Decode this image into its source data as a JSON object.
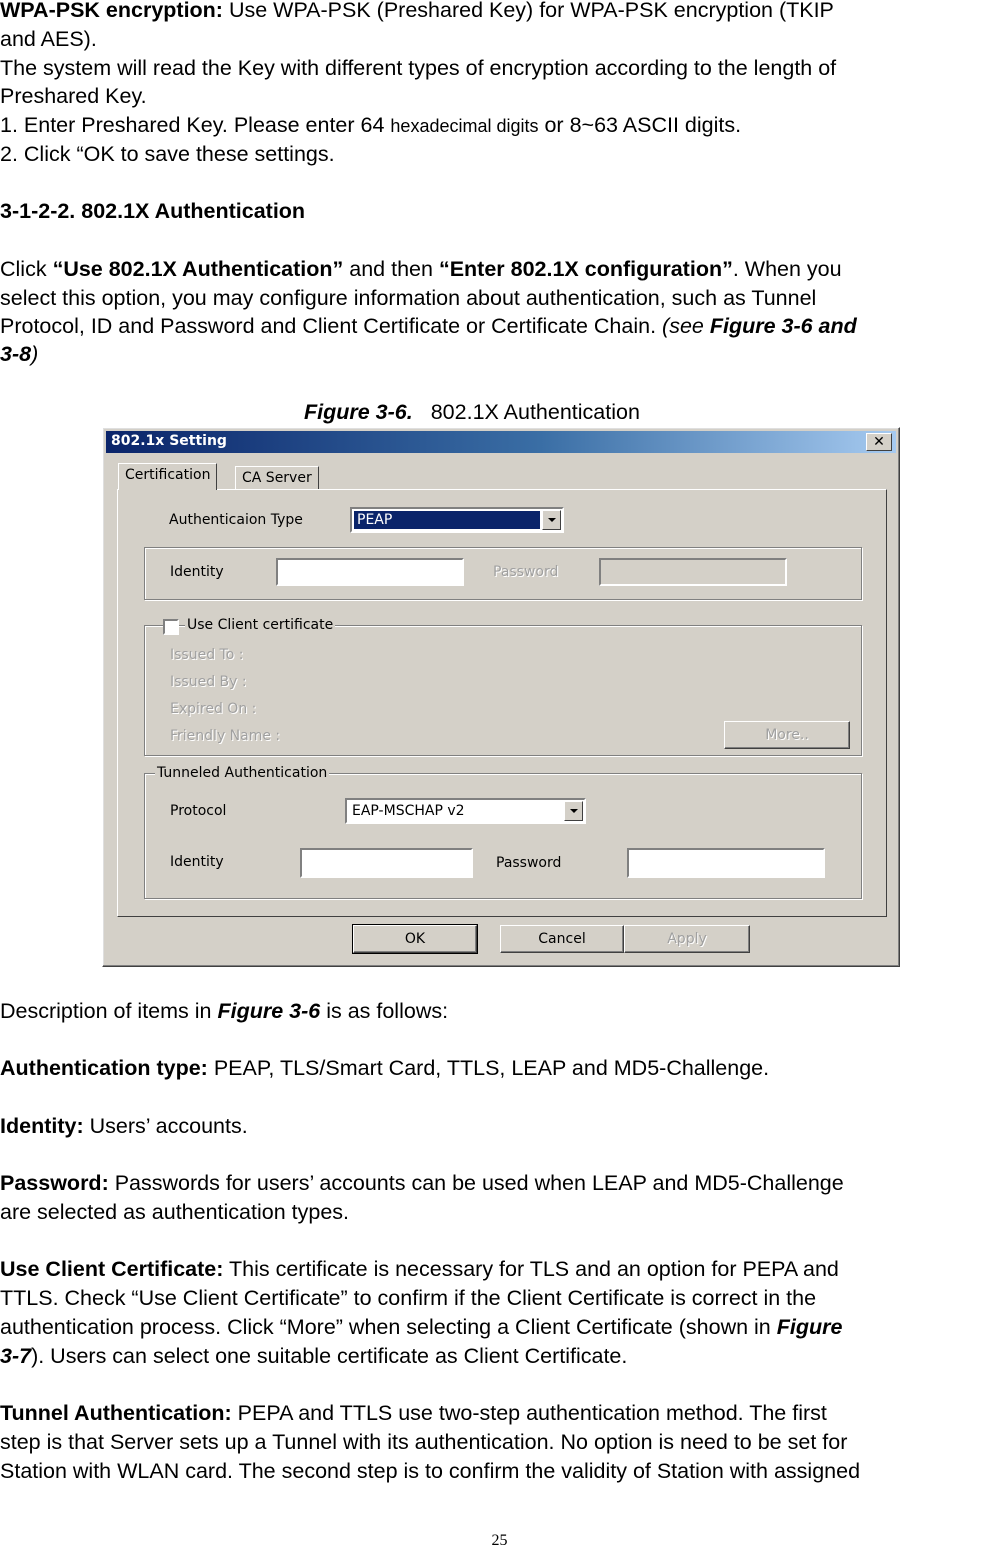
{
  "intro": {
    "wpa_label": "WPA-PSK encryption:",
    "wpa_text_1": " Use WPA-PSK (Preshared Key) for WPA-PSK encryption (TKIP",
    "wpa_text_2": "and AES).",
    "system_1": "The system will read the Key with different types of encryption according to the length of",
    "system_2": "Preshared Key.",
    "step1_a": "1. Enter Preshared Key. Please enter 64 ",
    "step1_b": "hexadecimal digits",
    "step1_c": " or 8~63 ASCII digits.",
    "step2": "2. Click “OK to save these settings."
  },
  "section": {
    "heading": "3-1-2-2.  802.1X Authentication",
    "p1_a": "Click ",
    "p1_b": "“Use 802.1X Authentication”",
    "p1_c": " and then ",
    "p1_d": "“Enter 802.1X configuration”",
    "p1_e": ". When you",
    "p2": "select this option, you may configure information about authentication, such as Tunnel",
    "p3_a": "Protocol, ID and Password and Client Certificate or Certificate Chain. ",
    "p3_b": "(see ",
    "p3_c": "Figure 3-6 and",
    "p4_a": "3-8",
    "p4_b": ")"
  },
  "figure": {
    "caption_label": "Figure 3-6.",
    "caption_text": "802.1X Authentication"
  },
  "dialog": {
    "title": "802.1x Setting",
    "close_glyph": "✕",
    "tabs": [
      {
        "label": "Certification",
        "active": true
      },
      {
        "label": "CA Server",
        "active": false
      }
    ],
    "auth_type_label": "Authenticaion Type",
    "auth_type_value": "PEAP",
    "identity_label": "Identity",
    "identity_value": "",
    "password_label": "Password",
    "password_value": "",
    "client_cert": {
      "checkbox_label": "Use Client certificate",
      "checked": false,
      "fields": [
        "Issued To :",
        "Issued By :",
        "Expired On :",
        "Friendly Name :"
      ],
      "more_button": "More.."
    },
    "tunneled": {
      "title": "Tunneled Authentication",
      "protocol_label": "Protocol",
      "protocol_value": "EAP-MSCHAP v2",
      "identity_label": "Identity",
      "identity_value": "",
      "password_label": "Password",
      "password_value": ""
    },
    "buttons": {
      "ok": "OK",
      "cancel": "Cancel",
      "apply": "Apply"
    }
  },
  "description": {
    "intro_a": "Description of items in ",
    "intro_b": "Figure 3-6",
    "intro_c": " is as follows:",
    "auth_label": "Authentication type:",
    "auth_text": " PEAP, TLS/Smart Card, TTLS, LEAP and MD5-Challenge.",
    "identity_label": "Identity:",
    "identity_text": " Users’ accounts.",
    "password_label": "Password:",
    "password_text_1": " Passwords for users’ accounts can be used when LEAP and MD5-Challenge",
    "password_text_2": "are selected as authentication types.",
    "ucc_label": "Use Client Certificate:",
    "ucc_text_1": " This certificate is necessary for TLS and an option for PEPA and",
    "ucc_text_2": "TTLS. Check “Use Client Certificate” to confirm if the Client Certificate is correct in the",
    "ucc_text_3a": "authentication process. Click “More” when selecting a Client Certificate (shown in ",
    "ucc_text_3b": "Figure",
    "ucc_text_4a": "3-7",
    "ucc_text_4b": "). Users can select one suitable certificate as Client Certificate.",
    "tunnel_label": "Tunnel Authentication:",
    "tunnel_text_1": " PEPA and TTLS use two-step authentication method. The first",
    "tunnel_text_2": "step is that Server sets up a Tunnel with its authentication. No option is need to be set for",
    "tunnel_text_3": "Station with WLAN card. The second step is to confirm the validity of Station with assigned"
  },
  "page_number": "25"
}
